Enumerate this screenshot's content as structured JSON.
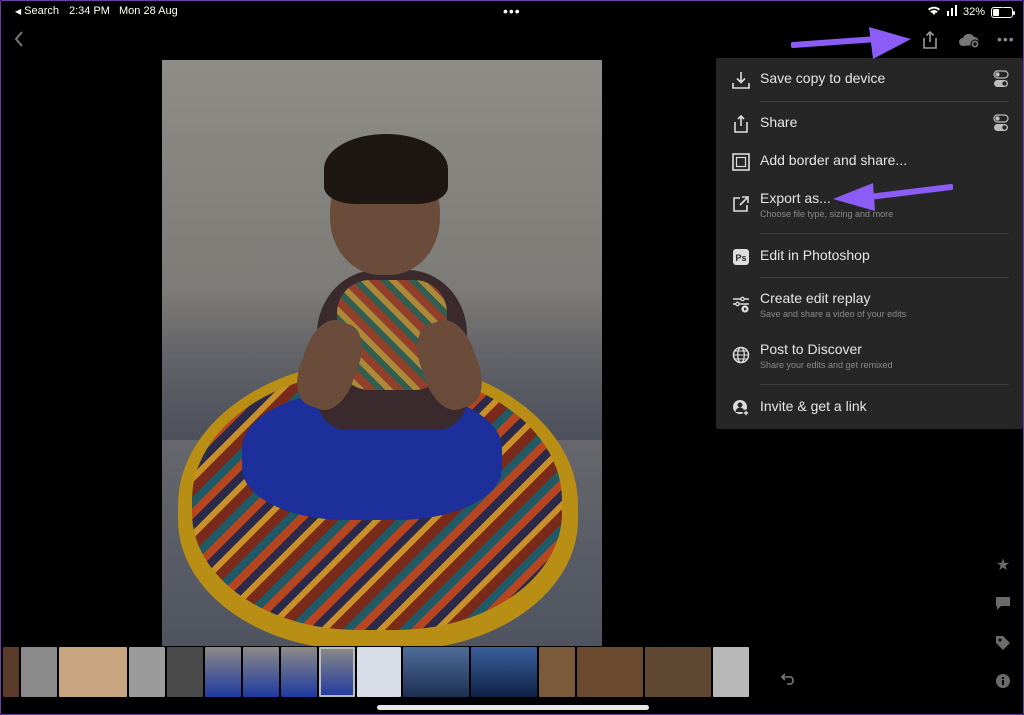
{
  "status_bar": {
    "back_app": "Search",
    "time": "2:34 PM",
    "date": "Mon 28 Aug",
    "battery": "32%",
    "battery_level": 0.32
  },
  "toolbar": {
    "back_icon": "chevron-left-icon",
    "share_icon": "share-icon",
    "cloud_icon": "cloud-add-icon",
    "more_icon": "more-icon"
  },
  "menu": {
    "items": [
      {
        "label": "Save copy to device",
        "sub": "",
        "icon": "download-icon",
        "toggle": true
      },
      {
        "label": "Share",
        "sub": "",
        "icon": "share-icon",
        "toggle": true
      },
      {
        "label": "Add border and share...",
        "sub": "",
        "icon": "border-icon",
        "toggle": false
      },
      {
        "label": "Export as...",
        "sub": "Choose file type, sizing and more",
        "icon": "export-icon",
        "toggle": false
      },
      {
        "label": "Edit in Photoshop",
        "sub": "",
        "icon": "photoshop-icon",
        "toggle": false
      },
      {
        "label": "Create edit replay",
        "sub": "Save and share a video of your edits",
        "icon": "replay-icon",
        "toggle": false
      },
      {
        "label": "Post to Discover",
        "sub": "Share your edits and get remixed",
        "icon": "globe-icon",
        "toggle": false
      },
      {
        "label": "Invite & get a link",
        "sub": "",
        "icon": "invite-icon",
        "toggle": false
      }
    ]
  },
  "colors": {
    "menu_bg": "#262626",
    "accent_arrow": "#8b5cf6",
    "frame_border": "#6a3fa0"
  },
  "side_icons": [
    "star-icon",
    "comment-icon",
    "tag-icon",
    "info-icon"
  ]
}
